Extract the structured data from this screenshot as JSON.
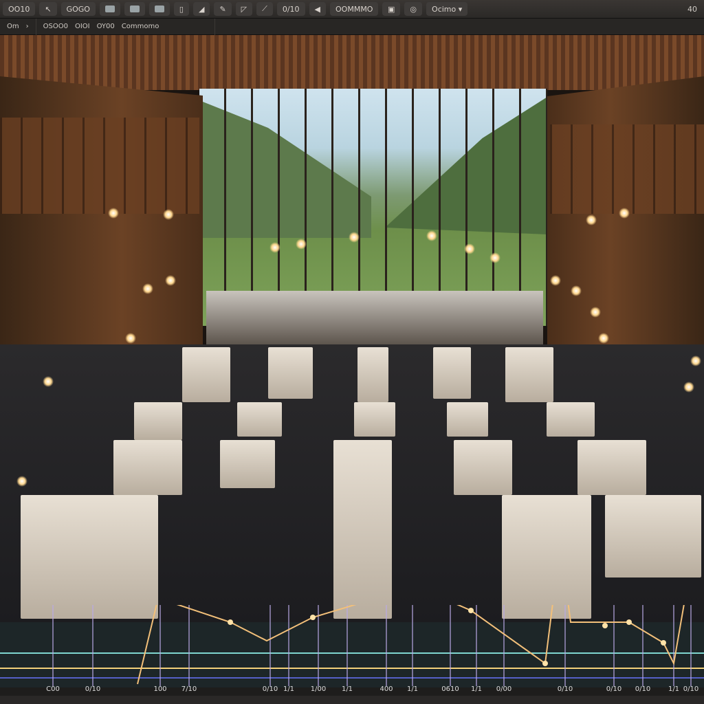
{
  "toolbar": {
    "items": [
      {
        "label": "OO10",
        "icon": "menu"
      },
      {
        "label": "",
        "icon": "arrow-icon"
      },
      {
        "label": "GOGO",
        "icon": ""
      },
      {
        "label": "",
        "icon": "rect-tool"
      },
      {
        "label": "",
        "icon": "rect-tool"
      },
      {
        "label": "",
        "icon": "rect-tool"
      },
      {
        "label": "",
        "icon": "frame-icon"
      },
      {
        "label": "",
        "icon": "brush-icon"
      },
      {
        "label": "",
        "icon": "pen-icon"
      },
      {
        "label": "",
        "icon": "crop-icon"
      },
      {
        "label": "",
        "icon": "knife-icon"
      },
      {
        "label": "0/10",
        "icon": ""
      },
      {
        "label": "",
        "icon": "speaker-icon"
      },
      {
        "label": "OOMMMO",
        "icon": ""
      },
      {
        "label": "",
        "icon": "clipboard-icon"
      },
      {
        "label": "",
        "icon": "circle-icon"
      },
      {
        "label": "Ocimo",
        "icon": "chevron-down-icon"
      }
    ],
    "right_label": "40"
  },
  "subbar": {
    "segments": [
      "Om",
      "OSOO0",
      "OIOI",
      "OY00",
      "Commomo"
    ]
  },
  "timeline": {
    "labels": [
      "C00",
      "0/10",
      "100",
      "7/10",
      "0/10",
      "1/1",
      "1/00",
      "1/1",
      "400",
      "1/1",
      "0610",
      "1/1",
      "0/00",
      "0/10",
      "0/10",
      "0/10",
      "1/1",
      "0/10"
    ],
    "colors": {
      "line": "#f3c07a",
      "cyan": "#7fd6d0",
      "yellow": "#f4d27a",
      "blue": "#5560c8"
    }
  }
}
